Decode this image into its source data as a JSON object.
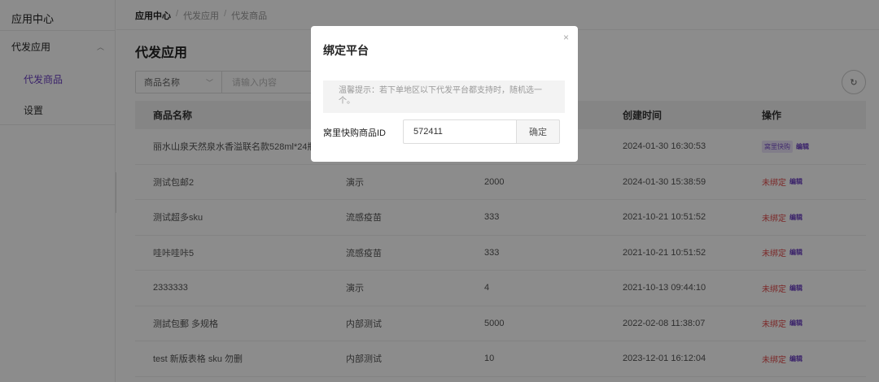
{
  "sidebar": {
    "title": "应用中心",
    "group": "代发应用",
    "items": [
      {
        "label": "代发商品"
      },
      {
        "label": "设置"
      }
    ]
  },
  "breadcrumb": [
    "应用中心",
    "代发应用",
    "代发商品"
  ],
  "page_title": "代发应用",
  "search": {
    "select_value": "商品名称",
    "placeholder": "请输入内容"
  },
  "table": {
    "headers": [
      "商品名称",
      "",
      "",
      "创建时间",
      "操作"
    ],
    "rows": [
      {
        "name": "丽水山泉天然泉水香溢联名款528ml*24瓶",
        "category": "",
        "stock": "",
        "created": "2024-01-30 16:30:53",
        "status": "窝里快购",
        "edit": "编辑"
      },
      {
        "name": "测试包邮2",
        "category": "演示",
        "stock": "2000",
        "created": "2024-01-30 15:38:59",
        "status": "未绑定",
        "edit": "编辑"
      },
      {
        "name": "测试超多sku",
        "category": "流感疫苗",
        "stock": "333",
        "created": "2021-10-21 10:51:52",
        "status": "未绑定",
        "edit": "编辑"
      },
      {
        "name": "哇咔哇咔5",
        "category": "流感疫苗",
        "stock": "333",
        "created": "2021-10-21 10:51:52",
        "status": "未绑定",
        "edit": "编辑"
      },
      {
        "name": "2333333",
        "category": "演示",
        "stock": "4",
        "created": "2021-10-13 09:44:10",
        "status": "未绑定",
        "edit": "编辑"
      },
      {
        "name": "测試包郵 多规格",
        "category": "内部测试",
        "stock": "5000",
        "created": "2022-02-08 11:38:07",
        "status": "未绑定",
        "edit": "编辑"
      },
      {
        "name": "test 新版表格 sku 勿删",
        "category": "内部测试",
        "stock": "10",
        "created": "2023-12-01 16:12:04",
        "status": "未绑定",
        "edit": "编辑"
      }
    ]
  },
  "modal": {
    "title": "绑定平台",
    "tip": "温馨提示：若下单地区以下代发平台都支持时，随机选一个。",
    "field_label": "窝里快购商品ID",
    "field_value": "572411",
    "confirm": "确定",
    "close_icon": "×"
  },
  "icons": {
    "collapse": "‹",
    "chevron_up": "︿",
    "dropdown": "﹀",
    "refresh": "↻"
  },
  "colors": {
    "accent": "#6a3fc2",
    "unbound": "#e04a4a",
    "tag_bg": "#ebe3fa"
  }
}
